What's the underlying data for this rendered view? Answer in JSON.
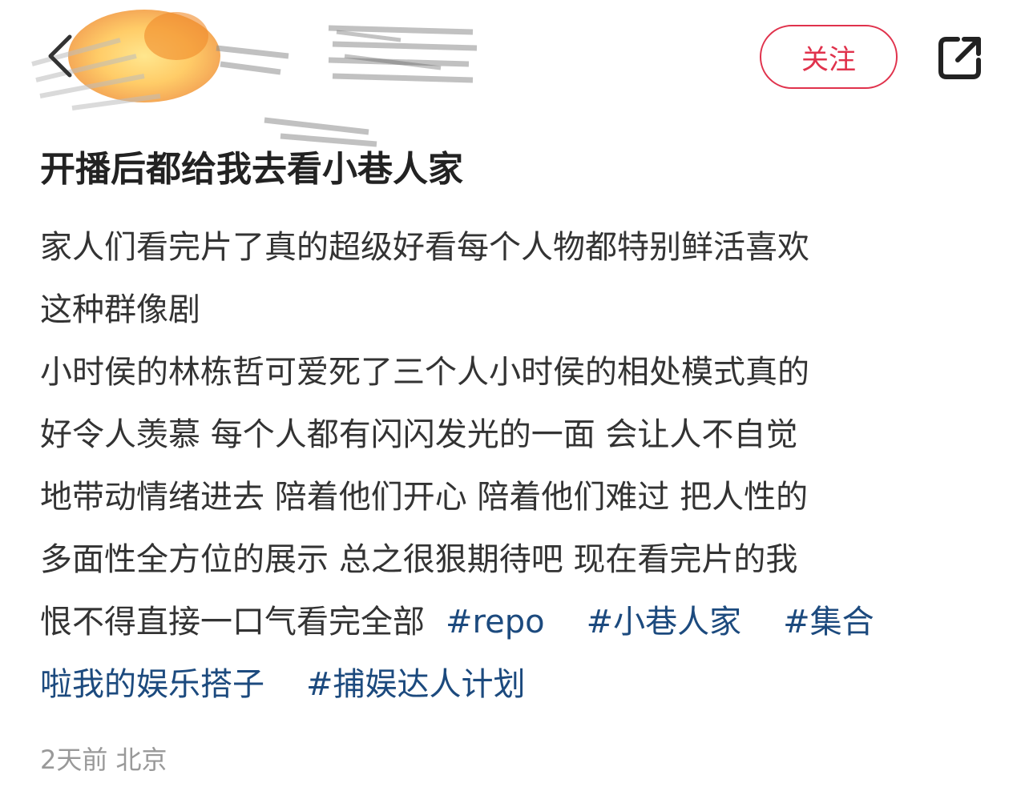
{
  "header": {
    "follow_label": "关注",
    "back_icon": "chevron-left-icon",
    "share_icon": "share-external-icon",
    "avatar_note": "redacted"
  },
  "post": {
    "title": "开播后都给我去看小巷人家",
    "lines": [
      {
        "text": "家人们看完片了真的超级好看每个人物都特别鲜活喜欢"
      },
      {
        "text": "这种群像剧"
      },
      {
        "text": "小时侯的林栋哲可爱死了三个人小时侯的相处模式真的"
      },
      {
        "text": "好令人羡慕 每个人都有闪闪发光的一面 会让人不自觉"
      },
      {
        "text": "地带动情绪进去 陪着他们开心 陪着他们难过 把人性的"
      },
      {
        "text": "多面性全方位的展示 总之很狠期待吧 现在看完片的我"
      },
      {
        "text": "恨不得直接一口气看完全部"
      }
    ],
    "hashtags": [
      "#repo",
      "#小巷人家",
      "#集合",
      "啦我的娱乐搭子",
      "#捕娱达人计划"
    ],
    "meta": "2天前 北京"
  },
  "colors": {
    "accent_red": "#e0324c",
    "hashtag_blue": "#1c4a7e",
    "meta_gray": "#999999"
  }
}
